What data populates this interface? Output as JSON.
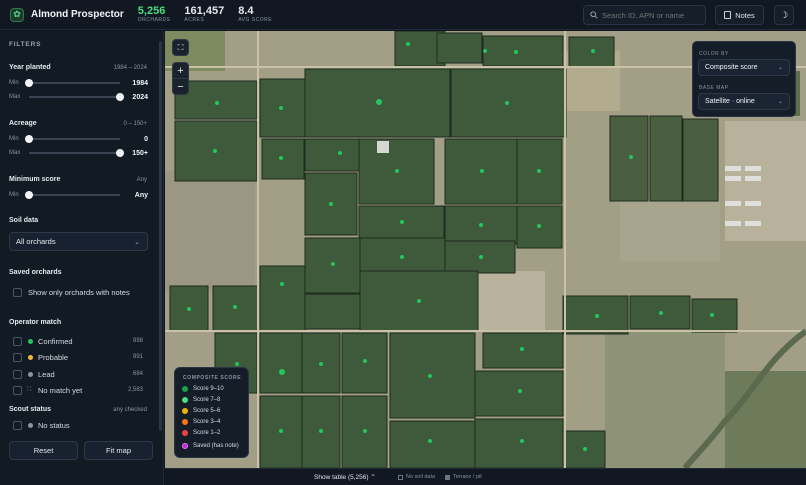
{
  "app": {
    "title": "Almond Prospector"
  },
  "stats": [
    {
      "value": "5,256",
      "label": "ORCHARDS",
      "color": "#4ade80"
    },
    {
      "value": "161,457",
      "label": "ACRES",
      "color": "#f2f4f7"
    },
    {
      "value": "8.4",
      "label": "AVG SCORE",
      "color": "#f2f4f7"
    }
  ],
  "search": {
    "placeholder": "Search ID, APN or name"
  },
  "header": {
    "notes_label": "Notes",
    "theme_icon": "moon-icon"
  },
  "filters": {
    "heading": "FILTERS",
    "year": {
      "label": "Year planted",
      "range": "1984 – 2024",
      "min_label": "Min",
      "min_value": "1984",
      "max_label": "Max",
      "max_value": "2024",
      "min_fraction": 0,
      "max_fraction": 1
    },
    "acreage": {
      "label": "Acreage",
      "range": "0 – 150+",
      "min_label": "Min",
      "min_value": "0",
      "max_label": "Max",
      "max_value": "150+",
      "min_fraction": 0,
      "max_fraction": 1
    },
    "score": {
      "label": "Minimum score",
      "range": "Any",
      "min_label": "Min",
      "min_value": "Any",
      "min_fraction": 0
    },
    "soil": {
      "label": "Soil data",
      "selected": "All orchards"
    },
    "saved": {
      "label": "Saved orchards",
      "checkbox_label": "Show only orchards with notes"
    },
    "operator": {
      "label": "Operator match",
      "items": [
        {
          "label": "Confirmed",
          "count": "998",
          "color": "#22c55e"
        },
        {
          "label": "Probable",
          "count": "991",
          "color": "#f5b83d"
        },
        {
          "label": "Lead",
          "count": "684",
          "color": "#8a94a3"
        },
        {
          "label": "No match yet",
          "count": "2,583",
          "color": "#8a94a3"
        }
      ]
    },
    "scout": {
      "label": "Scout status",
      "range": "any checked",
      "items": [
        {
          "label": "No status",
          "color": "#8a94a3"
        }
      ]
    },
    "reset_label": "Reset",
    "fit_label": "Fit map"
  },
  "map_panel": {
    "color_by_label": "COLOR BY",
    "color_by_value": "Composite score",
    "base_map_label": "BASE MAP",
    "base_map_value": "Satellite · online"
  },
  "legend": {
    "title": "COMPOSITE SCORE",
    "items": [
      {
        "label": "Score 9–10",
        "color": "#16a34a"
      },
      {
        "label": "Score 7–8",
        "color": "#4ade80"
      },
      {
        "label": "Score 5–6",
        "color": "#eab308"
      },
      {
        "label": "Score 3–4",
        "color": "#f97316"
      },
      {
        "label": "Score 1–2",
        "color": "#ef4444"
      },
      {
        "label": "Saved (has note)",
        "color": "#c026d3"
      }
    ]
  },
  "bottom": {
    "show_table": "Show table (5,256)",
    "no_soil": "No soil data",
    "terrace": "Terrace / pit"
  }
}
